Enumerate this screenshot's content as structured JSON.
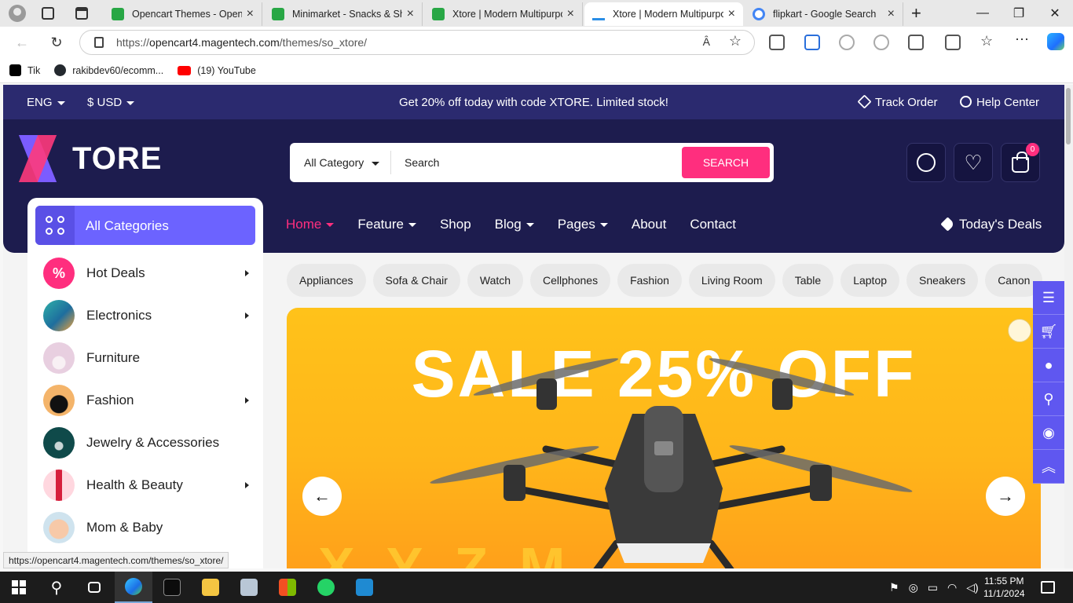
{
  "browser": {
    "tabs": [
      {
        "title": "Opencart Themes - Opencart",
        "favicon": "opencart-icon"
      },
      {
        "title": "Minimarket - Snacks & Shop",
        "favicon": "opencart-icon"
      },
      {
        "title": "Xtore | Modern Multipurpose",
        "favicon": "opencart-icon"
      },
      {
        "title": "Xtore | Modern Multipurpose",
        "favicon": "xtore-icon",
        "active": true
      },
      {
        "title": "flipkart - Google Search",
        "favicon": "google-icon"
      }
    ],
    "new_tab": "+",
    "url_prefix": "https://",
    "url_host": "opencart4.magentech.com",
    "url_path": "/themes/so_xtore/",
    "read_aloud": "Ȃ",
    "bookmarks": [
      {
        "label": "Tik",
        "icon": "tiktok-icon",
        "color": "#000000"
      },
      {
        "label": "rakibdev60/ecomm...",
        "icon": "github-icon",
        "color": "#24292f"
      },
      {
        "label": "(19) YouTube",
        "icon": "youtube-icon",
        "color": "#ff0000"
      }
    ],
    "status_url": "https://opencart4.magentech.com/themes/so_xtore/"
  },
  "topbar": {
    "language": "ENG",
    "currency": "$ USD",
    "promo": "Get 20% off today with code XTORE. Limited stock!",
    "track_order": "Track Order",
    "help_center": "Help Center"
  },
  "header": {
    "logo_text": "TORE",
    "search": {
      "category": "All Category",
      "placeholder": "Search",
      "button": "SEARCH"
    },
    "cart_count": "0"
  },
  "nav": {
    "items": [
      {
        "label": "Home",
        "dropdown": true,
        "active": true
      },
      {
        "label": "Feature",
        "dropdown": true
      },
      {
        "label": "Shop",
        "dropdown": false
      },
      {
        "label": "Blog",
        "dropdown": true
      },
      {
        "label": "Pages",
        "dropdown": true
      },
      {
        "label": "About",
        "dropdown": false
      },
      {
        "label": "Contact",
        "dropdown": false
      }
    ],
    "deals": "Today's Deals"
  },
  "sidebar": {
    "all_categories": "All Categories",
    "items": [
      {
        "label": "Hot Deals",
        "arrow": true,
        "icon": "percent-icon"
      },
      {
        "label": "Electronics",
        "arrow": true,
        "icon": "electronics-thumb"
      },
      {
        "label": "Furniture",
        "arrow": false,
        "icon": "lamp-thumb"
      },
      {
        "label": "Fashion",
        "arrow": true,
        "icon": "handbag-thumb"
      },
      {
        "label": "Jewelry & Accessories",
        "arrow": false,
        "icon": "necklace-thumb"
      },
      {
        "label": "Health & Beauty",
        "arrow": true,
        "icon": "lipstick-thumb"
      },
      {
        "label": "Mom & Baby",
        "arrow": false,
        "icon": "baby-thumb"
      }
    ]
  },
  "chips": [
    "Appliances",
    "Sofa & Chair",
    "Watch",
    "Cellphones",
    "Fashion",
    "Living Room",
    "Table",
    "Laptop",
    "Sneakers",
    "Canon"
  ],
  "banner": {
    "headline": "SALE 25% OFF"
  },
  "side_tools": [
    "menu-icon",
    "cart-icon",
    "user-icon",
    "search-icon",
    "eye-icon",
    "scroll-top-icon"
  ],
  "taskbar": {
    "time": "11:55 PM",
    "date": "11/1/2024"
  },
  "colors": {
    "topbar": "#2b2a6f",
    "header": "#1d1c4e",
    "accent_pink": "#ff2e7e",
    "accent_purple": "#6c63ff",
    "banner_yellow": "#ffb61a"
  }
}
